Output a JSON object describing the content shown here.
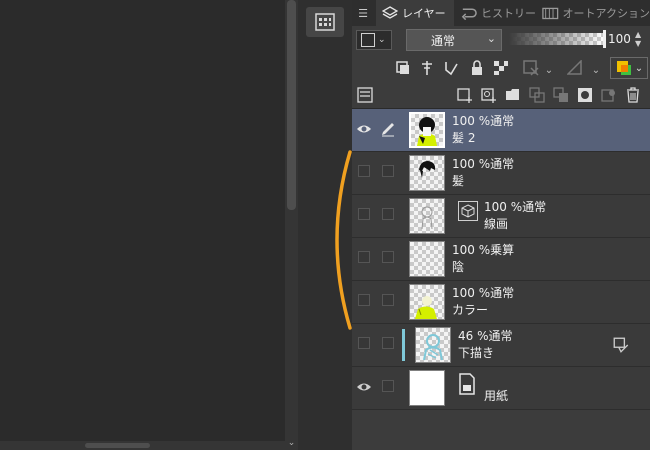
{
  "tabs": {
    "layer": "レイヤー",
    "history": "ヒストリー",
    "auto_action": "オートアクション"
  },
  "toolbar": {
    "blend_mode": "通常",
    "opacity": "100"
  },
  "layers": [
    {
      "opacity_mode": "100 %通常",
      "name": "髪 2",
      "visible": true,
      "selected": true,
      "type": "hair"
    },
    {
      "opacity_mode": "100 %通常",
      "name": "髪",
      "visible": false,
      "selected": false,
      "type": "hair"
    },
    {
      "opacity_mode": "100 %通常",
      "name": "線画",
      "visible": false,
      "selected": false,
      "type": "vector"
    },
    {
      "opacity_mode": "100 %乗算",
      "name": "陰",
      "visible": false,
      "selected": false,
      "type": "empty"
    },
    {
      "opacity_mode": "100 %通常",
      "name": "カラー",
      "visible": false,
      "selected": false,
      "type": "color"
    },
    {
      "opacity_mode": "46 %通常",
      "name": "下描き",
      "visible": false,
      "selected": false,
      "type": "sketch"
    },
    {
      "opacity_mode": "",
      "name": "用紙",
      "visible": true,
      "selected": false,
      "type": "paper"
    }
  ],
  "colors": {
    "panel_bg": "#3c3c3c",
    "selected_row": "#576179",
    "bracket": "#f0a020",
    "sketch_accent": "#7fc8d8"
  },
  "icons": [
    "menu-icon",
    "layer-stack-icon",
    "history-icon",
    "auto-action-icon",
    "navigator-icon",
    "eye-icon",
    "pen-icon",
    "lock-icon",
    "trash-icon",
    "new-layer-icon",
    "new-folder-icon",
    "mask-icon",
    "link-icon",
    "paper-icon"
  ]
}
